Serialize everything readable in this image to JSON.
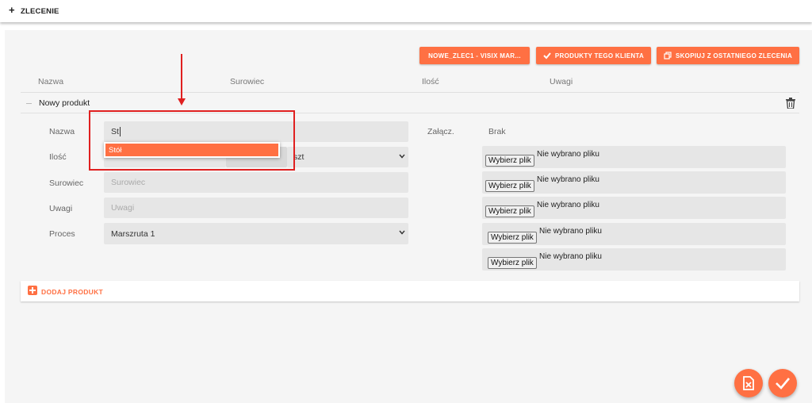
{
  "topbar": {
    "title": "ZLECENIE"
  },
  "toolbar": {
    "template_button": "NOWE_ZLEC1 - VISIX MAR...",
    "client_products_button": "PRODUKTY TEGO KLIENTA",
    "copy_last_button": "SKOPIUJ Z OSTATNIEGO ZLECENIA"
  },
  "table": {
    "columns": [
      "Nazwa",
      "Surowiec",
      "Ilość",
      "Uwagi"
    ]
  },
  "product": {
    "title": "Nowy produkt",
    "labels": {
      "name": "Nazwa",
      "qty": "Ilość",
      "material": "Surowiec",
      "notes": "Uwagi",
      "process": "Proces",
      "attach": "Załącz."
    },
    "name_value": "St",
    "autocomplete_option": "Stół",
    "qty_unit": "szt",
    "material_placeholder": "Surowiec",
    "notes_placeholder": "Uwagi",
    "process_value": "Marszruta 1",
    "attach_value": "Brak",
    "files": [
      {
        "button": "Wybierz plik",
        "status": "Nie wybrano pliku"
      },
      {
        "button": "Wybierz plik",
        "status": "Nie wybrano pliku"
      },
      {
        "button": "Wybierz plik",
        "status": "Nie wybrano pliku"
      },
      {
        "button": "Wybierz plik",
        "status": "Nie wybrano pliku"
      },
      {
        "button": "Wybierz plik",
        "status": "Nie wybrano pliku"
      }
    ]
  },
  "add_product": {
    "label": "DODAJ PRODUKT"
  },
  "colors": {
    "accent": "#ff7043",
    "annotation": "#e02020"
  },
  "icons": [
    "plus-icon",
    "check-icon",
    "copy-icon",
    "trash-icon",
    "chevron-down-icon",
    "add-square-icon",
    "delete-file-icon",
    "checkmark-icon",
    "arrow-down-icon"
  ]
}
